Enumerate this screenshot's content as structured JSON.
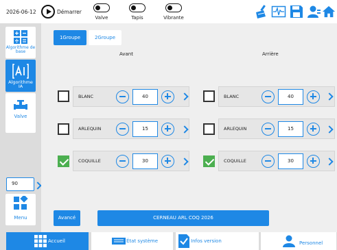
{
  "topbar": {
    "date": "2026-06-12",
    "start_label": "Démarrer",
    "toggles": [
      {
        "label": "Valve"
      },
      {
        "label": "Tapis"
      },
      {
        "label": "Vibrante"
      }
    ],
    "icons": [
      "broom-icon",
      "waveform-icon",
      "save-icon",
      "user-icon",
      "home-icon"
    ]
  },
  "sidebar": {
    "items": [
      {
        "label": "Algorithme de base",
        "icon": "calculator-icon"
      },
      {
        "label": "Algorithme IA",
        "icon": "ai-icon"
      },
      {
        "label": "Valve",
        "icon": "valve-icon"
      }
    ],
    "speed_value": "90",
    "menu_label": "Menu"
  },
  "main": {
    "tabs": [
      {
        "label": "1Groupe"
      },
      {
        "label": "2Groupe"
      }
    ],
    "columns": {
      "front": "Avant",
      "rear": "Arrière"
    },
    "front_rows": [
      {
        "name": "BLANC",
        "value": "40",
        "checked": false
      },
      {
        "name": "ARLEQUIN",
        "value": "15",
        "checked": false
      },
      {
        "name": "COQUILLE",
        "value": "30",
        "checked": true
      }
    ],
    "rear_rows": [
      {
        "name": "BLANC",
        "value": "40",
        "checked": false
      },
      {
        "name": "ARLEQUIN",
        "value": "15",
        "checked": false
      },
      {
        "name": "COQUILLE",
        "value": "30",
        "checked": true
      }
    ],
    "advance_label": "Avancé",
    "recipe_name": "CERNEAU ARL COQ 2026"
  },
  "bottomnav": {
    "items": [
      {
        "label": "Accueil"
      },
      {
        "label": "État système"
      },
      {
        "label": "Infos version"
      },
      {
        "label": "Personnel"
      }
    ]
  },
  "colors": {
    "accent": "#1e88e5",
    "check_green": "#4caf50",
    "panel_bg": "#efefef"
  }
}
